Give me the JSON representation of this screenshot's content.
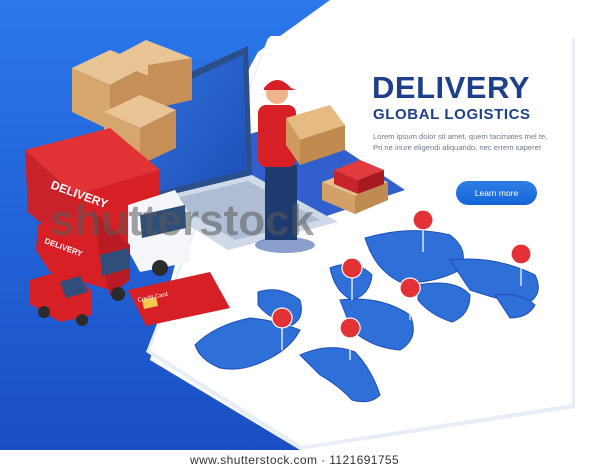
{
  "banner": {
    "title": "DELIVERY",
    "subtitle": "GLOBAL LOGISTICS",
    "body_lines": [
      "Lorem ipsum dolor sit amet, quem tacimates mel te.",
      "Pri ne iriure eligendi aliquando, nec errem saperet"
    ],
    "cta_label": "Learn more",
    "truck_label": "DELIVERY",
    "van_label": "DELIVERY",
    "card_label": "Credit Card"
  },
  "watermark": "shutterstock",
  "footer": {
    "text": "www.shutterstock.com · 1121691755"
  },
  "colors": {
    "blue_bg": "#1f5fd6",
    "dark_blue": "#1e3f8a",
    "button": "#1f6fe0",
    "red": "#d71f26",
    "map_blue": "#2f6fd8"
  }
}
